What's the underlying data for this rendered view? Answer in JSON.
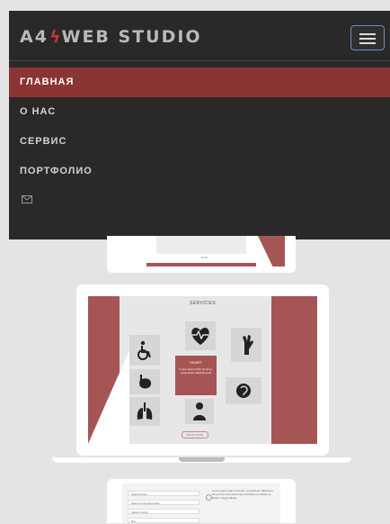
{
  "header": {
    "brand_prefix": "A4",
    "brand_suffix": "WEB STUDIO",
    "menu_toggle_icon": "hamburger-icon"
  },
  "menu": {
    "items": [
      {
        "label": "ГЛАВНАЯ",
        "active": true
      },
      {
        "label": "О НАС",
        "active": false
      },
      {
        "label": "СЕРВИС",
        "active": false
      },
      {
        "label": "ПОРТФОЛИО",
        "active": false
      }
    ],
    "mail_icon": "envelope-icon"
  },
  "colors": {
    "nav_background": "#292929",
    "accent": "#8b3434",
    "page_background": "#e4e4e4"
  },
  "portfolio": {
    "mockup_top": {
      "footer_text": "NOW"
    },
    "mockup_main": {
      "title": "SERVICES",
      "highlight_title": "HEART",
      "highlight_text": "Lorem ipsum dolor sit amet, consectetur adipiscing elit",
      "button_label": "READ MORE",
      "icons": [
        "wheelchair-icon",
        "heart-pulse-icon",
        "stomach-icon",
        "hand-icon",
        "lungs-icon",
        "doctor-icon",
        "ear-icon"
      ]
    },
    "mockup_bottom": {
      "rows": [
        "Select Doctor",
        "Select Convenient Date",
        "Select County",
        "Ent"
      ],
      "text": "Lorem ipsum dolor sit amet, consectetur adipiscing elit sed do eiusmod tempor incididunt ut labore et dolore magna aliqua"
    }
  }
}
